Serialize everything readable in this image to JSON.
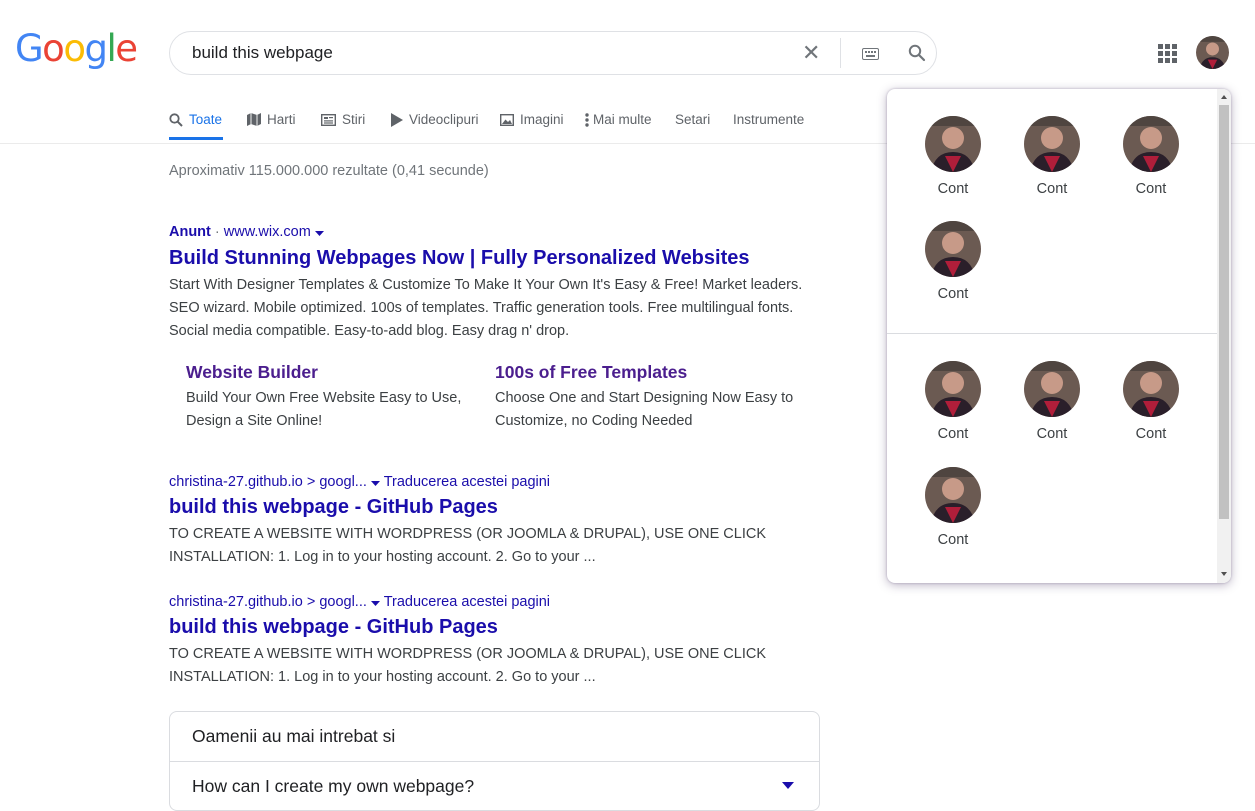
{
  "logo": {
    "letters": [
      "G",
      "o",
      "o",
      "g",
      "l",
      "e"
    ],
    "colors": [
      "#4285f4",
      "#ea4335",
      "#fbbc05",
      "#4285f4",
      "#34a853",
      "#ea4335"
    ]
  },
  "search": {
    "query": "build this webpage"
  },
  "tabs": [
    {
      "label": "Toate",
      "icon": "search-icon",
      "active": true
    },
    {
      "label": "Harti",
      "icon": "map-icon"
    },
    {
      "label": "Stiri",
      "icon": "news-icon"
    },
    {
      "label": "Videoclipuri",
      "icon": "play-icon"
    },
    {
      "label": "Imagini",
      "icon": "image-icon"
    },
    {
      "label": "Mai multe",
      "icon": "more-vert-icon"
    },
    {
      "label": "Setari"
    },
    {
      "label": "Instrumente"
    }
  ],
  "stats": "Aproximativ 115.000.000 rezultate (0,41 secunde)",
  "ad": {
    "label": "Anunt",
    "separator": "·",
    "url": "www.wix.com",
    "title": "Build Stunning Webpages Now | Fully Personalized Websites",
    "snippet": "Start With Designer Templates & Customize To Make It Your Own It's Easy & Free! Market leaders. SEO wizard. Mobile optimized. 100s of templates. Traffic generation tools. Free multilingual fonts. Social media compatible. Easy-to-add blog. Easy drag n' drop.",
    "sitelinks": [
      {
        "title": "Website Builder",
        "desc": "Build Your Own Free Website Easy to Use, Design a Site Online!"
      },
      {
        "title": "100s of Free Templates",
        "desc": "Choose One and Start Designing Now Easy to Customize, no Coding Needed"
      }
    ]
  },
  "results": [
    {
      "url": "christina-27.github.io > googl...",
      "translate": "Traducerea acestei pagini",
      "title": "build this webpage - GitHub Pages",
      "snippet": "TO CREATE A WEBSITE WITH WORDPRESS (OR JOOMLA & DRUPAL), USE ONE CLICK INSTALLATION: 1. Log in to your hosting account. 2. Go to your ..."
    },
    {
      "url": "christina-27.github.io > googl...",
      "translate": "Traducerea acestei pagini",
      "title": "build this webpage - GitHub Pages",
      "snippet": "TO CREATE A WEBSITE WITH WORDPRESS (OR JOOMLA & DRUPAL), USE ONE CLICK INSTALLATION: 1. Log in to your hosting account. 2. Go to your ..."
    }
  ],
  "paa": {
    "heading": "Oamenii au mai intrebat si",
    "question": "How can I create my own webpage?"
  },
  "accounts_panel": {
    "group1": [
      "Cont",
      "Cont",
      "Cont",
      "Cont"
    ],
    "group2": [
      "Cont",
      "Cont",
      "Cont",
      "Cont"
    ]
  }
}
